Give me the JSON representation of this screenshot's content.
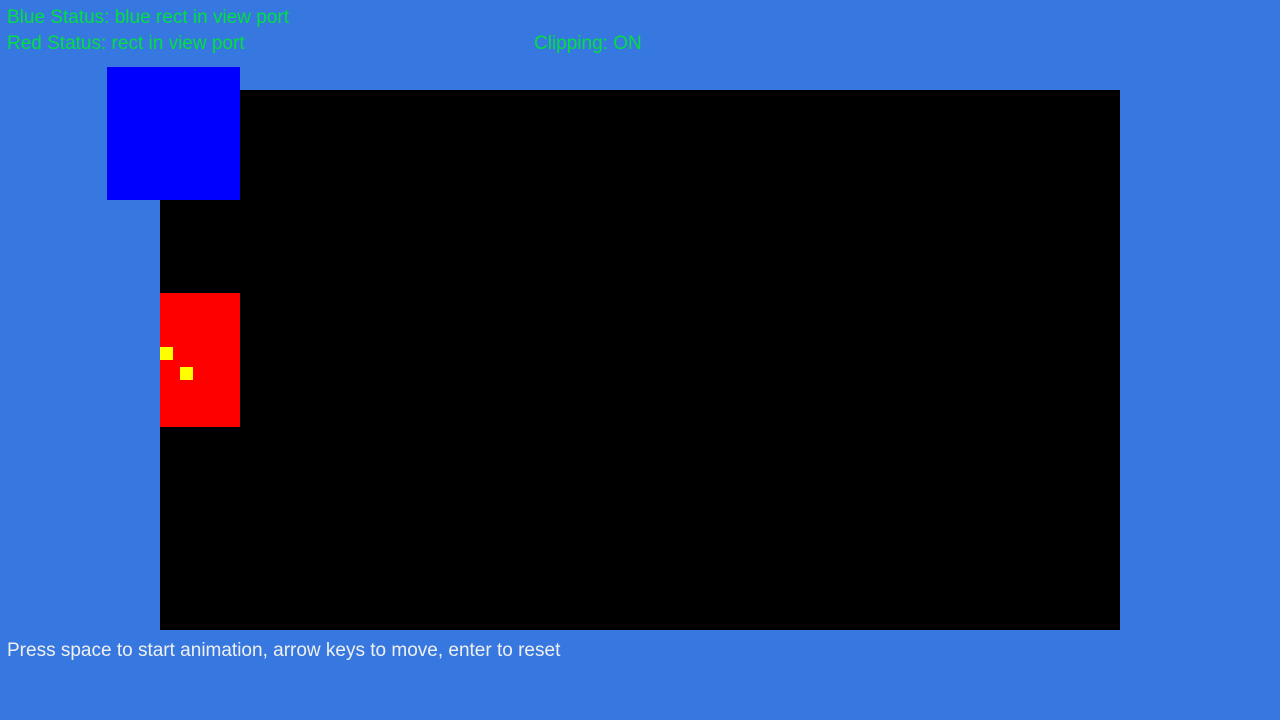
{
  "hud": {
    "blue_status": "Blue Status: blue rect in view port",
    "red_status": "Red Status: rect in view port",
    "clipping_status": "Clipping: ON"
  },
  "footer": {
    "instructions": "Press space to start animation, arrow keys to move, enter to reset"
  },
  "colors": {
    "background": "#3778e0",
    "status_text": "#00e040",
    "instructions_text": "#f0f0f0",
    "viewport": "#000000",
    "blue_rect": "#0000ff",
    "red_rect": "#ff0000",
    "marker": "#ffff00"
  }
}
